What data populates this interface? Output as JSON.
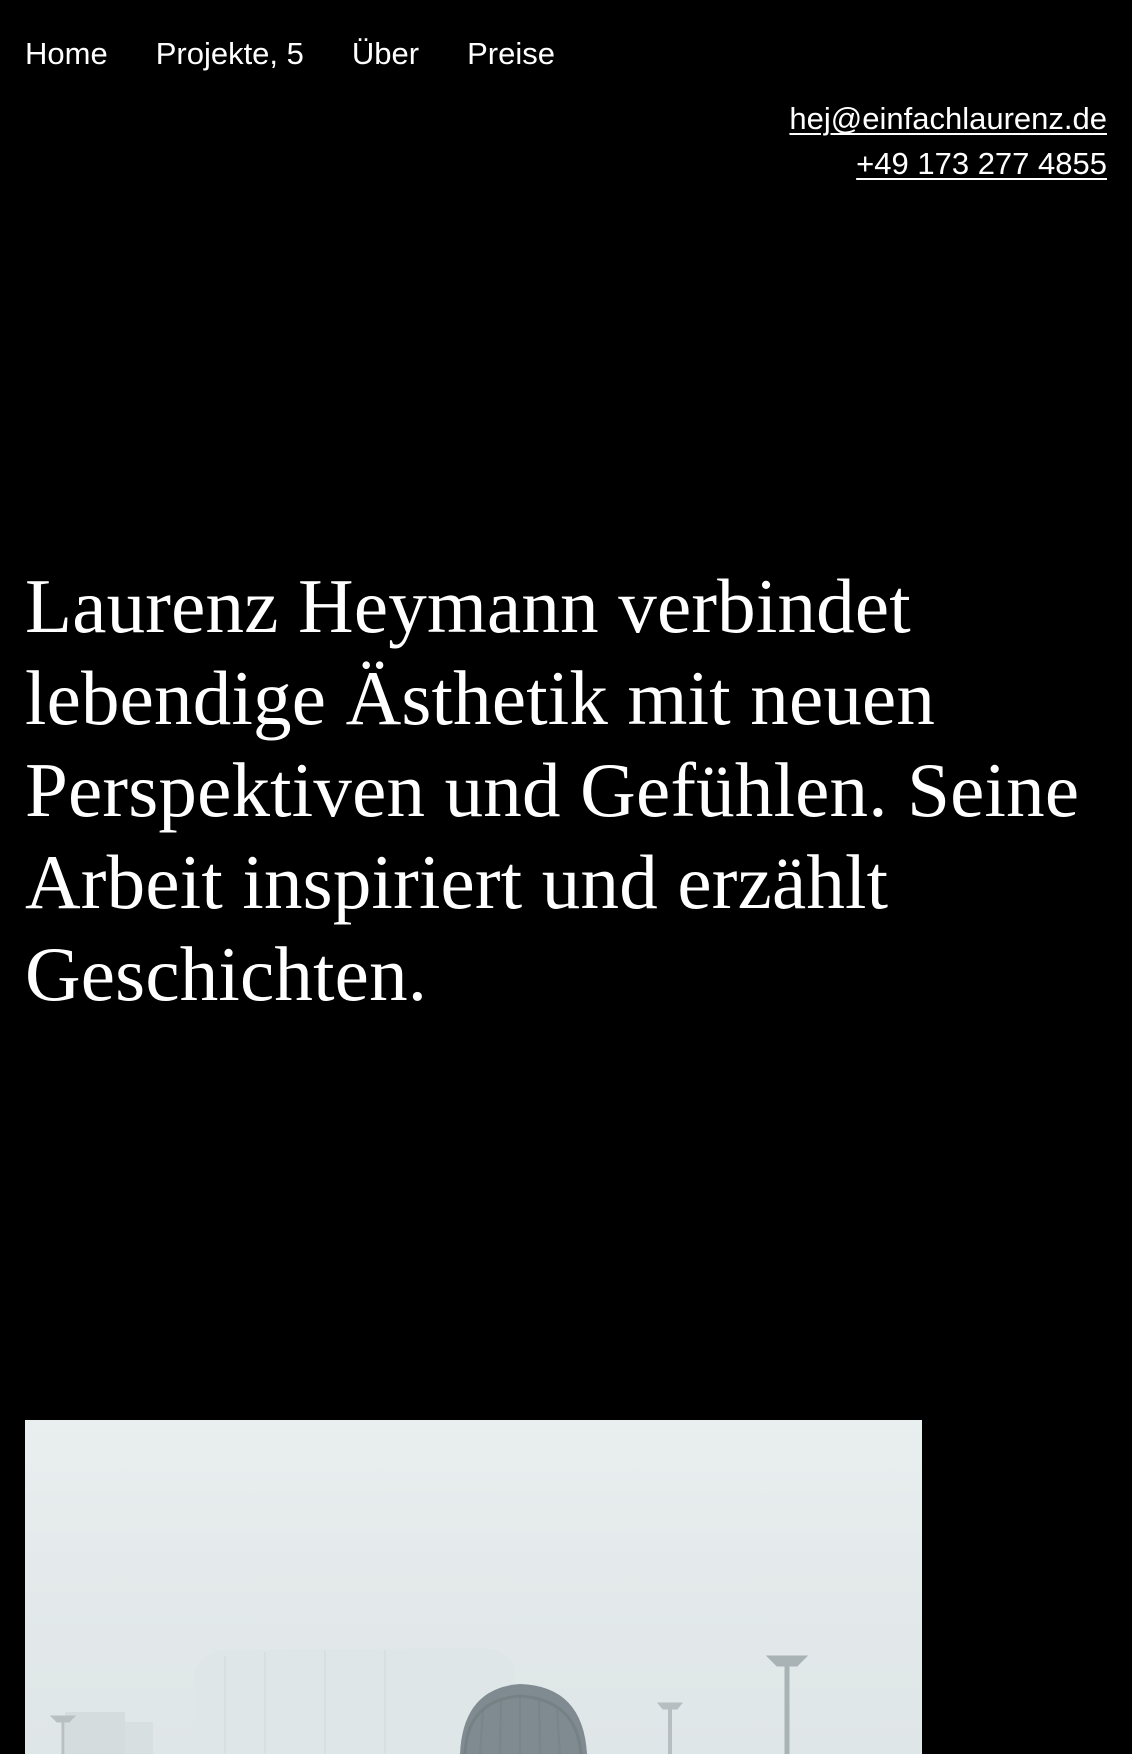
{
  "nav": {
    "items": [
      {
        "label": "Home"
      },
      {
        "label": "Projekte, 5"
      },
      {
        "label": "Über"
      },
      {
        "label": "Preise"
      }
    ]
  },
  "contact": {
    "email": "hej@einfachlaurenz.de",
    "phone": "+49 173 277 4855"
  },
  "hero": {
    "headline": "Laurenz Heymann verbindet lebendige Ästhetik mit neuen Perspektiven und Gefühlen. Seine Arbeit inspiriert und erzählt Geschichten."
  },
  "colors": {
    "background": "#000000",
    "text": "#ffffff",
    "photo_sky": "#e6ecec",
    "beanie": "#7f8b90"
  }
}
